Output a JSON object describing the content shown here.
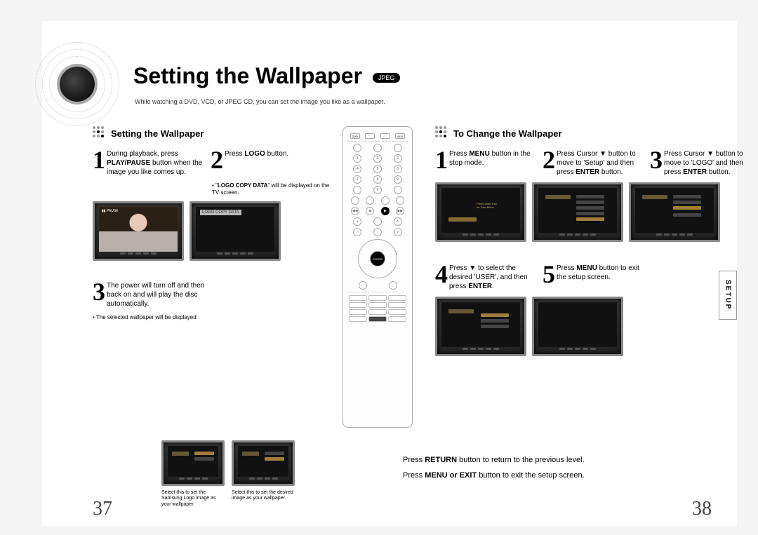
{
  "title": "Setting the Wallpaper",
  "badge": "JPEG",
  "subtitle": "While watching a DVD, VCD, or JPEG CD, you can set the image you like as a wallpaper.",
  "side_tab": "SETUP",
  "page_left": "37",
  "page_right": "38",
  "left": {
    "heading": "Setting the Wallpaper",
    "step1": {
      "num": "1",
      "text_before": "During playback, press ",
      "bold": "PLAY/PAUSE",
      "text_after": " button when the image you like comes up."
    },
    "step2": {
      "num": "2",
      "text_before": "Press ",
      "bold": "LOGO",
      "text_after": " button."
    },
    "note2_before": "\"",
    "note2_bold": "LOGO COPY DATA",
    "note2_after": "\" will be displayed on the TV screen.",
    "step3": {
      "num": "3",
      "text": "The power will turn off and then back on and will play the disc automatically."
    },
    "note3": "The selected wallpaper will be displayed.",
    "logo_copy_label": "LOGO COPY DATA",
    "pause_label": "PAUSE"
  },
  "right": {
    "heading": "To Change the Wallpaper",
    "step1": {
      "num": "1",
      "text_before": "Press ",
      "bold": "MENU",
      "text_after": " button in the stop mode."
    },
    "step2": {
      "num": "2",
      "text_before": "Press Cursor ▼ button to move to 'Setup' and then press ",
      "bold": "ENTER",
      "text_after": " button."
    },
    "step3": {
      "num": "3",
      "text_before": "Press Cursor ▼ button to move to 'LOGO' and then press ",
      "bold": "ENTER",
      "text_after": " button."
    },
    "step4": {
      "num": "4",
      "text_before": "Press ▼ to select the desired 'USER', and then press ",
      "bold": "ENTER",
      "text_after": "."
    },
    "step5": {
      "num": "5",
      "text_before": "Press ",
      "bold": "MENU",
      "text_after": " button to exit the setup screen."
    }
  },
  "bottom_thumbs": {
    "cap1": "Select this to set the Samsung Logo image as your wallpaper.",
    "cap2": "Select this to set the desired image as your wallpaper."
  },
  "info": {
    "line1_before": "Press ",
    "line1_bold": "RETURN",
    "line1_after": " button to return to the previous level.",
    "line2_before": "Press ",
    "line2_bold": "MENU or EXIT",
    "line2_after": " button to exit the setup screen."
  },
  "remote_center": "ENTER"
}
